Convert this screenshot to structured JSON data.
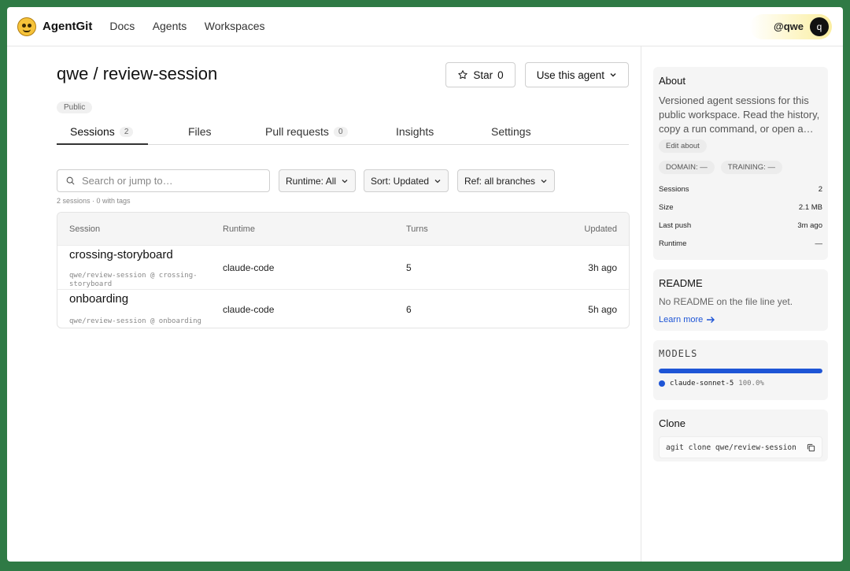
{
  "app": {
    "brand": "AgentGit"
  },
  "nav": {
    "docs": "Docs",
    "agents": "Agents",
    "workspaces": "Workspaces"
  },
  "user": {
    "handle": "@qwe",
    "avatar_letter": "q"
  },
  "repo": {
    "title": "qwe / review-session",
    "visibility": "Public",
    "star_label": "Star",
    "star_count": "0",
    "use_agent_label": "Use this agent"
  },
  "tabs": {
    "sessions": {
      "label": "Sessions",
      "count": "2"
    },
    "files": {
      "label": "Files"
    },
    "pull_requests": {
      "label": "Pull requests",
      "count": "0"
    },
    "insights": {
      "label": "Insights"
    },
    "settings": {
      "label": "Settings"
    }
  },
  "filters": {
    "search_placeholder": "Search or jump to…",
    "runtime": "Runtime: All",
    "sort": "Sort: Updated",
    "ref": "Ref: all branches",
    "summary": "2 sessions · 0 with tags"
  },
  "table": {
    "headers": {
      "session": "Session",
      "runtime": "Runtime",
      "turns": "Turns",
      "updated": "Updated"
    },
    "rows": [
      {
        "name": "crossing-storyboard",
        "path": "qwe/review-session @ crossing-storyboard",
        "runtime": "claude-code",
        "turns": "5",
        "updated": "3h ago"
      },
      {
        "name": "onboarding",
        "path": "qwe/review-session @ onboarding",
        "runtime": "claude-code",
        "turns": "6",
        "updated": "5h ago"
      }
    ]
  },
  "about": {
    "title": "About",
    "text": "Versioned agent sessions for this public workspace. Read the history, copy a run command, or open a…",
    "edit_label": "Edit about",
    "domain_chip": "DOMAIN: —",
    "training_chip": "TRAINING: —",
    "stats": [
      {
        "label": "Sessions",
        "value": "2"
      },
      {
        "label": "Size",
        "value": "2.1 MB"
      },
      {
        "label": "Last push",
        "value": "3m ago"
      },
      {
        "label": "Runtime",
        "value": "—"
      }
    ]
  },
  "readme": {
    "title": "README",
    "text": "No README on the file line yet.",
    "learn_more": "Learn more"
  },
  "models": {
    "title": "MODELS",
    "items": [
      {
        "name": "claude-sonnet-5",
        "pct_label": "100.0%",
        "fraction": 1.0
      }
    ]
  },
  "clone": {
    "title": "Clone",
    "command": "agit clone qwe/review-session"
  },
  "colors": {
    "accent": "#1e55d6",
    "frame": "#2f7a45"
  }
}
